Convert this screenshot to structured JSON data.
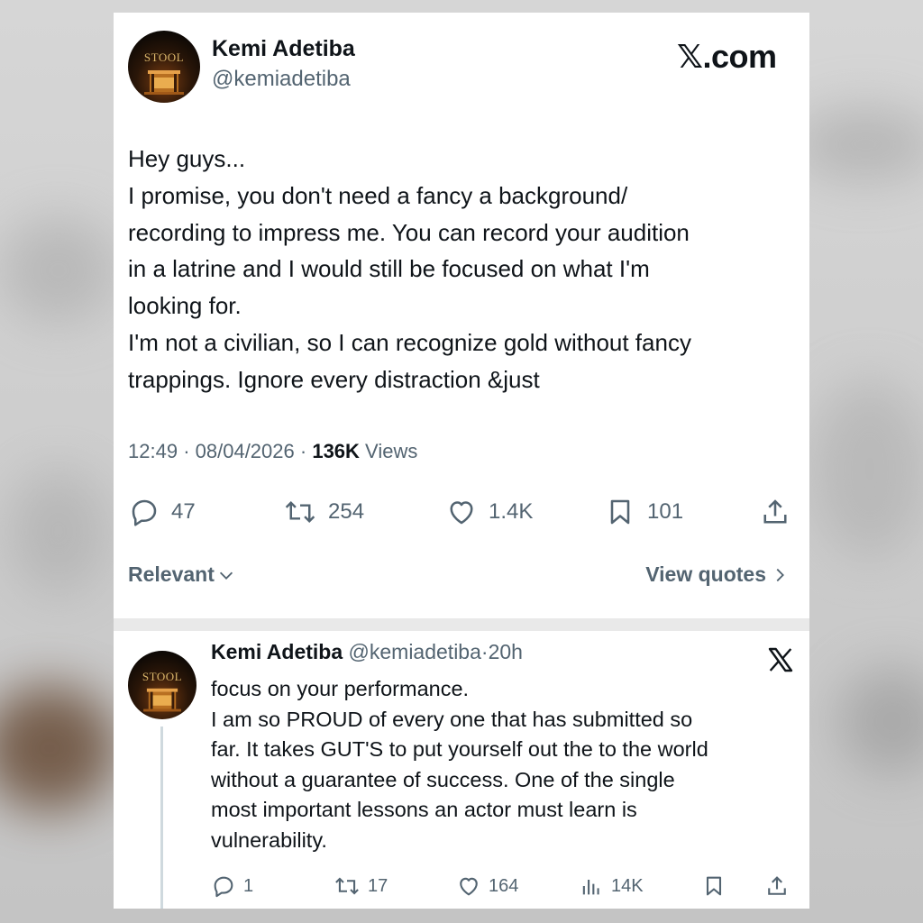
{
  "tweet": {
    "author_name": "Kemi Adetiba",
    "author_handle": "@kemiadetiba",
    "avatar_logo_text": "STOOL",
    "brand": "𝕏.com",
    "text_lines": [
      "Hey guys...",
      "I promise, you don't need a fancy a background/",
      "recording to impress me. You can record your audition",
      "in a latrine and I would still be focused on what I'm",
      "looking for.",
      "I'm not a civilian, so I can recognize gold without fancy",
      "trappings. Ignore every distraction &just"
    ],
    "time": "12:49",
    "date": "08/04/2026",
    "views_count": "136K",
    "views_label": "Views",
    "actions": {
      "replies": "47",
      "reposts": "254",
      "likes": "1.4K",
      "bookmarks": "101"
    },
    "icons": [
      "reply-icon",
      "repost-icon",
      "like-icon",
      "bookmark-icon",
      "share-icon"
    ]
  },
  "sort": {
    "relevant_label": "Relevant",
    "view_quotes_label": "View quotes"
  },
  "reply": {
    "author_name": "Kemi Adetiba",
    "author_handle": "@kemiadetiba",
    "separator": "·",
    "age": "20h",
    "avatar_logo_text": "STOOL",
    "text_lines": [
      "focus on your performance.",
      "I am so PROUD of every one that has submitted so",
      "far. It takes GUT'S to put yourself out the to the world",
      "without a guarantee of success. One of the single",
      "most important lessons an actor must learn is",
      "vulnerability."
    ],
    "actions": {
      "replies": "1",
      "reposts": "17",
      "likes": "164",
      "views": "14K"
    }
  },
  "colors": {
    "text": "#0f1419",
    "muted": "#536471",
    "card": "#ffffff",
    "divider": "#e9e9e9",
    "thread_line": "#cfd9de"
  }
}
